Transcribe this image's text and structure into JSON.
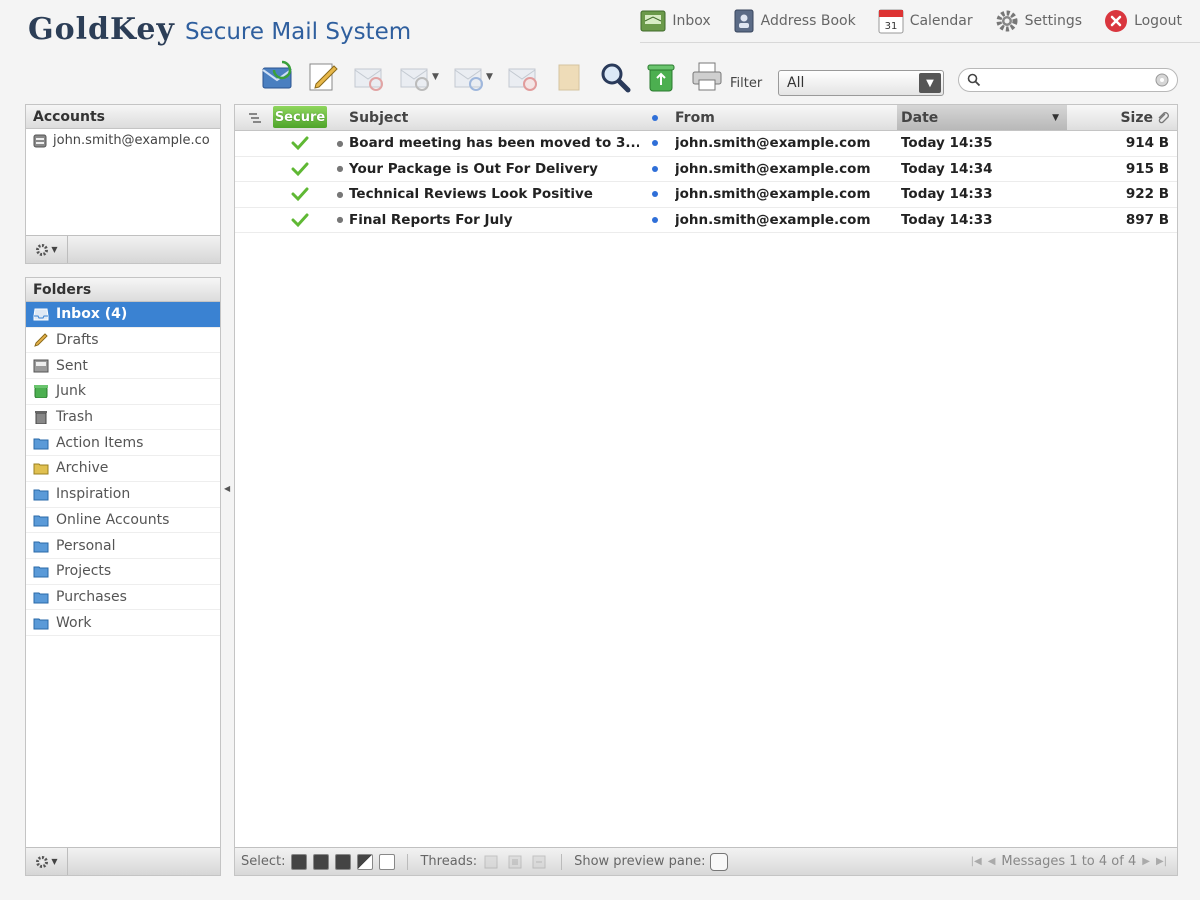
{
  "brand": {
    "name": "GoldKey",
    "tagline": "Secure Mail System"
  },
  "topnav": [
    {
      "label": "Inbox",
      "icon": "inbox-icon"
    },
    {
      "label": "Address Book",
      "icon": "address-book-icon"
    },
    {
      "label": "Calendar",
      "icon": "calendar-icon",
      "icon_text": "31"
    },
    {
      "label": "Settings",
      "icon": "gear-icon"
    },
    {
      "label": "Logout",
      "icon": "logout-icon"
    }
  ],
  "toolbar": {
    "filter_label": "Filter",
    "filter_value": "All",
    "search_placeholder": ""
  },
  "accounts": {
    "title": "Accounts",
    "items": [
      {
        "label": "john.smith@example.co"
      }
    ]
  },
  "folders": {
    "title": "Folders",
    "items": [
      {
        "label": "Inbox (4)",
        "icon": "inbox-folder-icon",
        "active": true
      },
      {
        "label": "Drafts",
        "icon": "pencil-icon"
      },
      {
        "label": "Sent",
        "icon": "sent-icon"
      },
      {
        "label": "Junk",
        "icon": "junk-icon"
      },
      {
        "label": "Trash",
        "icon": "trash-icon"
      },
      {
        "label": "Action Items",
        "icon": "folder-icon"
      },
      {
        "label": "Archive",
        "icon": "archive-icon"
      },
      {
        "label": "Inspiration",
        "icon": "folder-icon"
      },
      {
        "label": "Online Accounts",
        "icon": "folder-icon"
      },
      {
        "label": "Personal",
        "icon": "folder-icon"
      },
      {
        "label": "Projects",
        "icon": "folder-icon"
      },
      {
        "label": "Purchases",
        "icon": "folder-icon"
      },
      {
        "label": "Work",
        "icon": "folder-icon"
      }
    ]
  },
  "messages": {
    "columns": {
      "secure": "Secure",
      "subject": "Subject",
      "from": "From",
      "date": "Date",
      "size": "Size"
    },
    "rows": [
      {
        "subject": "Board meeting has been moved to 3...",
        "from": "john.smith@example.com",
        "date": "Today 14:35",
        "size": "914 B"
      },
      {
        "subject": "Your Package is Out For Delivery",
        "from": "john.smith@example.com",
        "date": "Today 14:34",
        "size": "915 B"
      },
      {
        "subject": "Technical Reviews Look Positive",
        "from": "john.smith@example.com",
        "date": "Today 14:33",
        "size": "922 B"
      },
      {
        "subject": "Final Reports For July",
        "from": "john.smith@example.com",
        "date": "Today 14:33",
        "size": "897 B"
      }
    ],
    "footer": {
      "select_label": "Select:",
      "threads_label": "Threads:",
      "preview_label": "Show preview pane:",
      "pager_text": "Messages 1 to 4 of 4"
    }
  },
  "colors": {
    "accent": "#3a82d2",
    "secure_green": "#5fb834",
    "brand_navy": "#2c3e57",
    "brand_blue": "#2f5f9e"
  }
}
